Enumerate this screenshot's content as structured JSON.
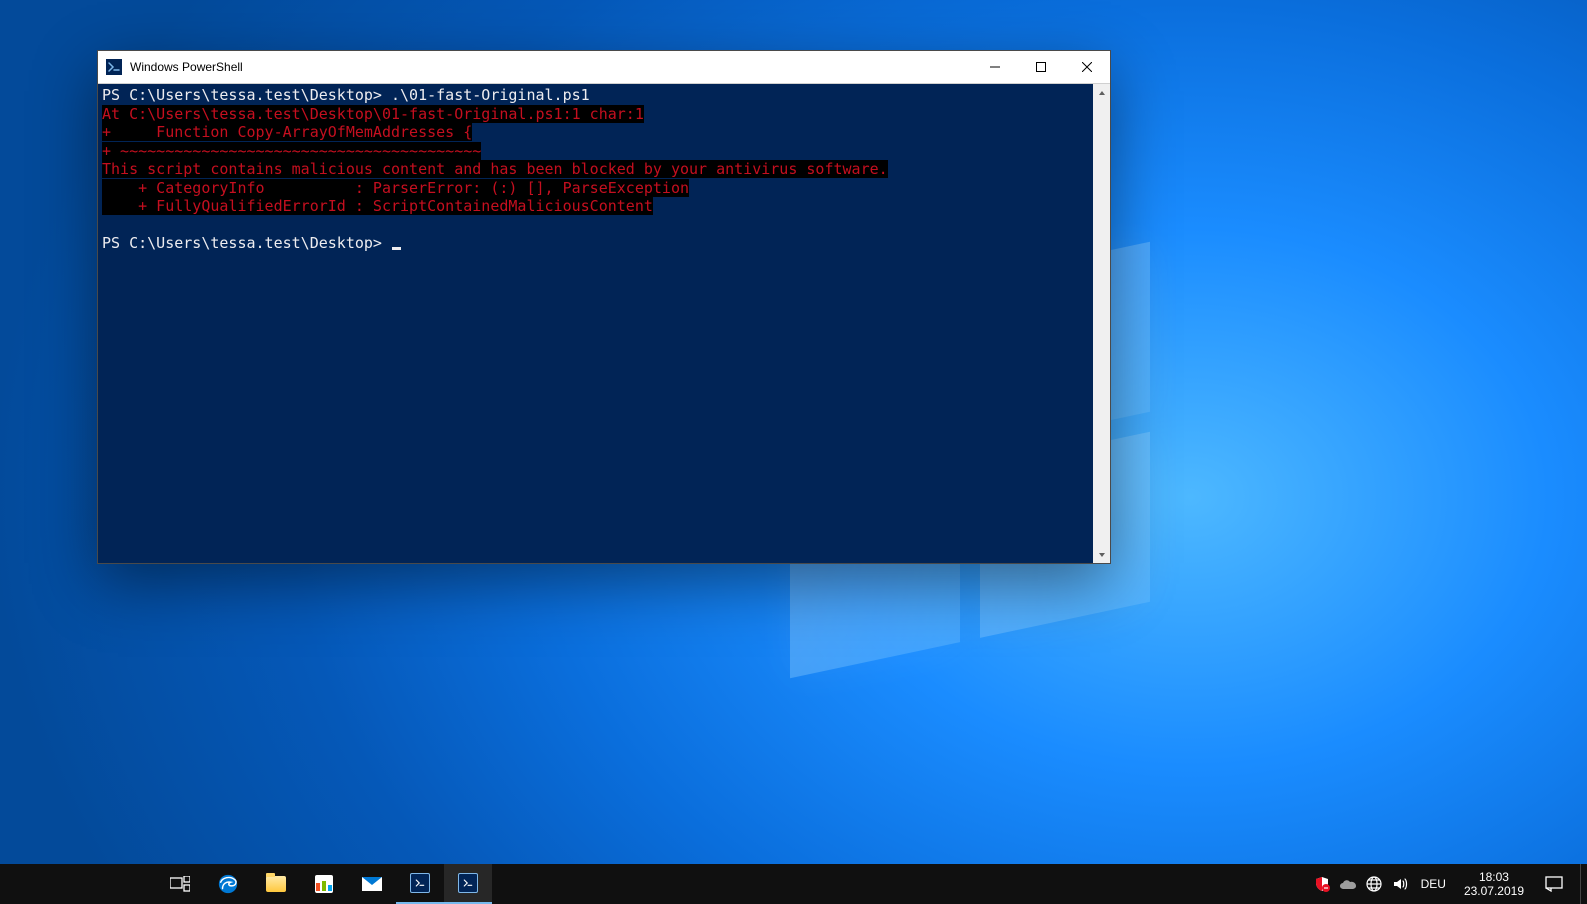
{
  "window": {
    "title": "Windows PowerShell"
  },
  "console": {
    "prompt1": "PS C:\\Users\\tessa.test\\Desktop> .\\01-fast-Original.ps1",
    "err1": "At C:\\Users\\tessa.test\\Desktop\\01-fast-Original.ps1:1 char:1",
    "err2": "+     Function Copy-ArrayOfMemAddresses {",
    "err3": "+ ~~~~~~~~~~~~~~~~~~~~~~~~~~~~~~~~~~~~~~~~",
    "err4": "This script contains malicious content and has been blocked by your antivirus software.",
    "err5": "    + CategoryInfo          : ParserError: (:) [], ParseException",
    "err6": "    + FullyQualifiedErrorId : ScriptContainedMaliciousContent",
    "blank": " ",
    "prompt2": "PS C:\\Users\\tessa.test\\Desktop> "
  },
  "taskbar": {
    "lang": "DEU",
    "time": "18:03",
    "date": "23.07.2019"
  }
}
